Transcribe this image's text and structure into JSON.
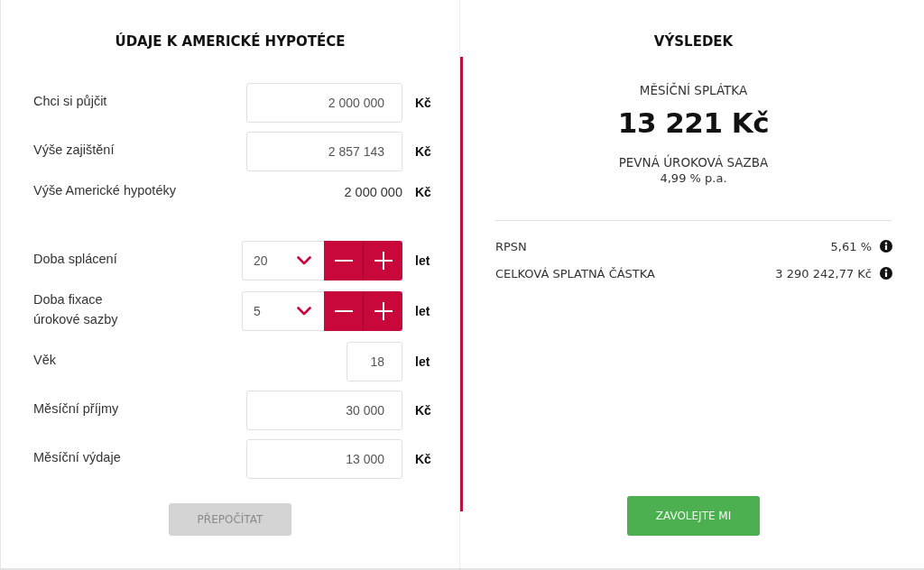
{
  "loan_form": {
    "title": "ÚDAJE K AMERICKÉ HYPOTÉCE",
    "groups": [
      {
        "fields": [
          {
            "kind": "input",
            "label": "Chci si půjčit",
            "value": "2 000 000",
            "unit": "Kč"
          },
          {
            "kind": "input",
            "label": "Výše zajištění",
            "value": "2 857 143",
            "unit": "Kč"
          },
          {
            "kind": "readout",
            "label": "Výše Americké hypotéky",
            "value": "2 000 000",
            "unit": "Kč"
          }
        ]
      },
      {
        "fields": [
          {
            "kind": "stepper",
            "label": "Doba splácení",
            "value": "20",
            "unit": "let"
          },
          {
            "kind": "stepper",
            "label": "Doba fixace\núrokové sazby",
            "value": "5",
            "unit": "let"
          },
          {
            "kind": "short",
            "label": "Věk",
            "value": "18",
            "unit": "let"
          },
          {
            "kind": "input",
            "label": "Měsíční příjmy",
            "value": "30 000",
            "unit": "Kč"
          },
          {
            "kind": "input",
            "label": "Měsíční výdaje",
            "value": "13 000",
            "unit": "Kč"
          }
        ]
      }
    ],
    "recalculate_button": {
      "label": "PŘEPOČÍTAT",
      "disabled": true
    }
  },
  "result": {
    "title": "VÝSLEDEK",
    "monthly_payment": {
      "label": "MĚSÍČNÍ SPLÁTKA",
      "value": "13 221 Kč"
    },
    "interest_rate": {
      "label": "PEVNÁ ÚROKOVÁ SAZBA",
      "value": "4,99 % p.a."
    },
    "details": [
      {
        "label": "RPSN",
        "value": "5,61 %"
      },
      {
        "label": "CELKOVÁ SPLATNÁ ČÁSTKA",
        "value": "3 290 242,77 Kč"
      }
    ],
    "call_button": {
      "label": "ZAVOLEJTE MI"
    }
  }
}
